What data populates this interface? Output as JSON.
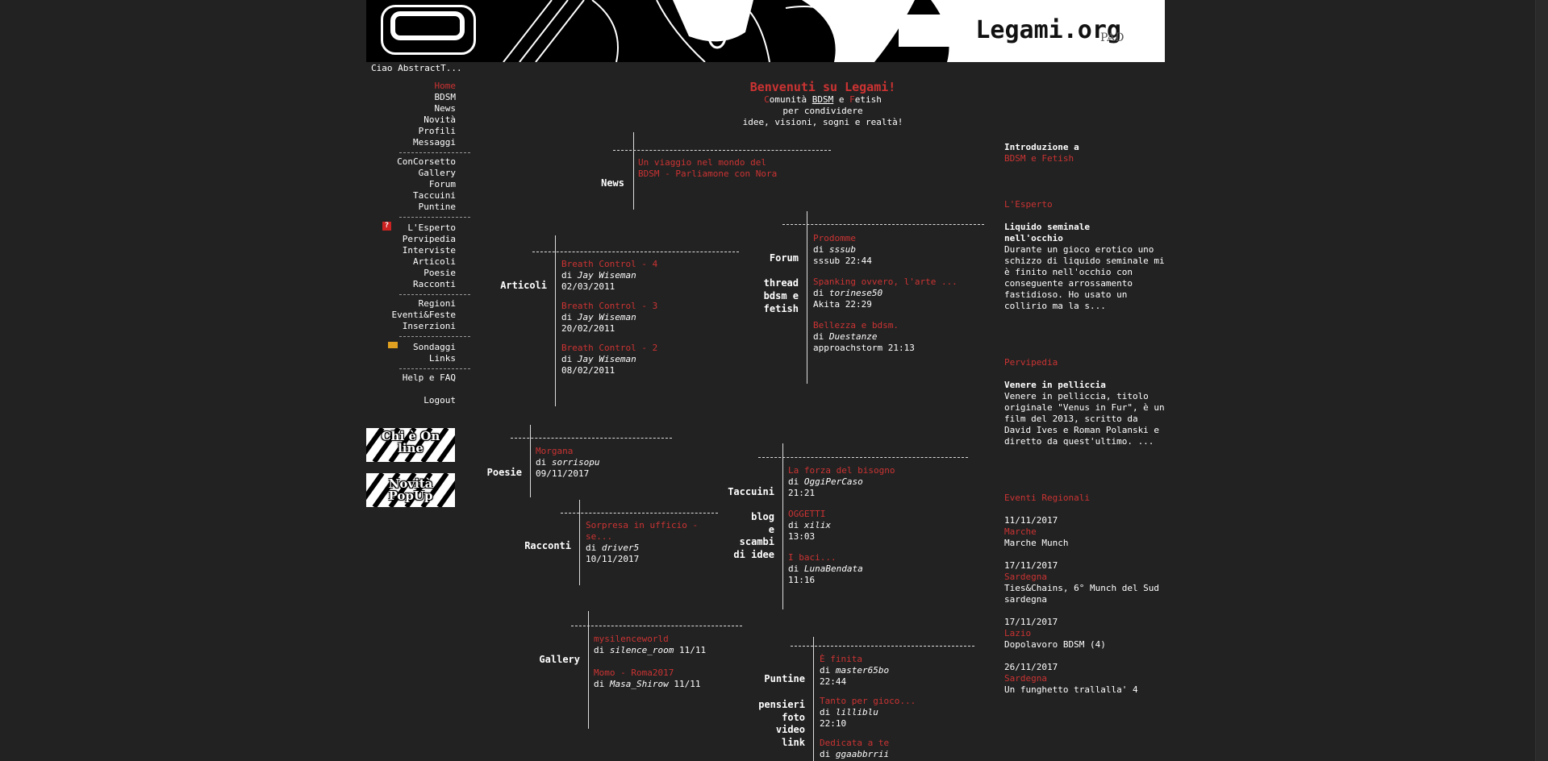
{
  "banner": {
    "site_title": "Legami.org",
    "signature": "PAD"
  },
  "greeting": "Ciao AbstractT...",
  "sidebar": {
    "group1": [
      "Home",
      "BDSM",
      "News",
      "Novità",
      "Profili",
      "Messaggi"
    ],
    "group2": [
      "ConCorsetto",
      "Gallery",
      "Forum",
      "Taccuini",
      "Puntine"
    ],
    "group3": [
      "L'Esperto",
      "Pervipedia",
      "Interviste",
      "Articoli",
      "Poesie",
      "Racconti"
    ],
    "group4": [
      "Regioni",
      "Eventi&Feste",
      "Inserzioni"
    ],
    "group5": [
      "Sondaggi",
      "Links"
    ],
    "group6": [
      "Help e FAQ"
    ],
    "logout": "Logout",
    "badge_online": "Chi è On line",
    "badge_popup": "Novità PopUp"
  },
  "welcome": {
    "title": "Benvenuti su Legami!",
    "line1_a": "C",
    "line1_b": "omunità ",
    "line1_c": "BDSM",
    "line1_d": " e ",
    "line1_e": "F",
    "line1_f": "etish",
    "line2": "per condividere",
    "line3": "idee, visioni, sogni e realtà!"
  },
  "news": {
    "label": "News",
    "item": "Un viaggio nel mondo del BDSM - Parliamone con Nora"
  },
  "articoli": {
    "label": "Articoli",
    "items": [
      {
        "title": "Breath Control - 4",
        "by": "di ",
        "author": "Jay Wiseman",
        "date": "02/03/2011"
      },
      {
        "title": "Breath Control - 3",
        "by": "di ",
        "author": "Jay Wiseman",
        "date": "20/02/2011"
      },
      {
        "title": "Breath Control - 2",
        "by": "di ",
        "author": "Jay Wiseman",
        "date": "08/02/2011"
      }
    ]
  },
  "forum": {
    "label": "Forum",
    "sublabel": [
      "thread",
      "bdsm e",
      "fetish"
    ],
    "items": [
      {
        "title": "Prodomme",
        "by": "di ",
        "author": "sssub",
        "meta": "sssub 22:44"
      },
      {
        "title": "Spanking ovvero, l'arte ...",
        "by": "di ",
        "author": "torinese50",
        "meta": "Akita 22:29"
      },
      {
        "title": "Bellezza e bdsm.",
        "by": "di ",
        "author": "Duestanze",
        "meta": "approachstorm 21:13"
      }
    ]
  },
  "poesie": {
    "label": "Poesie",
    "item": {
      "title": "Morgana",
      "by": "di ",
      "author": "sorrisopu",
      "date": "09/11/2017"
    }
  },
  "racconti": {
    "label": "Racconti",
    "item": {
      "title": "Sorpresa in ufficio - se...",
      "by": "di ",
      "author": "driver5",
      "date": "10/11/2017"
    }
  },
  "taccuini": {
    "label": "Taccuini",
    "sublabel": [
      "blog",
      "e",
      "scambi",
      "di idee"
    ],
    "items": [
      {
        "title": "La forza del bisogno",
        "by": "di ",
        "author": "OggiPerCaso",
        "time": "21:21"
      },
      {
        "title": "OGGETTI",
        "by": "di ",
        "author": "xilix",
        "time": "13:03"
      },
      {
        "title": "I baci...",
        "by": "di ",
        "author": "LunaBendata",
        "time": "11:16"
      }
    ]
  },
  "gallery": {
    "label": "Gallery",
    "items": [
      {
        "title": "mysilenceworld",
        "by": "di ",
        "author": "silence_room",
        "date": " 11/11"
      },
      {
        "title": "Momo - Roma2017",
        "by": "di ",
        "author": "Masa_Shirow",
        "date": " 11/11"
      }
    ]
  },
  "puntine": {
    "label": "Puntine",
    "sublabel": [
      "pensieri",
      "foto",
      "video",
      "link"
    ],
    "items": [
      {
        "title": "È finita",
        "by": "di ",
        "author": "master65bo",
        "time": "22:44"
      },
      {
        "title": "Tanto per gioco...",
        "by": "di ",
        "author": "lilliblu",
        "time": "22:10"
      },
      {
        "title": "Dedicata a te",
        "by": "di ",
        "author": "ggaabbrrii",
        "time": ""
      }
    ]
  },
  "right": {
    "intro_title": "Introduzione a",
    "intro_link": "BDSM e Fetish",
    "esperto_heading": "L'Esperto",
    "esperto_title": "Liquido seminale nell'occhio",
    "esperto_text": "Durante un gioco erotico uno schizzo di liquido seminale mi è finito nell'occhio con conseguente arrossamento fastidioso. Ho usato un collirio ma la s...",
    "pervipedia_heading": "Pervipedia",
    "pervipedia_title": "Venere in pelliccia",
    "pervipedia_text": "Venere in pelliccia, titolo originale \"Venus in Fur\", è un film del 2013, scritto da David Ives e Roman Polanski e diretto da quest'ultimo. ...",
    "eventi_heading": "Eventi Regionali",
    "eventi": [
      {
        "date": "11/11/2017",
        "region": "Marche",
        "name": "Marche Munch"
      },
      {
        "date": "17/11/2017",
        "region": "Sardegna",
        "name": "Ties&Chains, 6° Munch del Sud sardegna"
      },
      {
        "date": "17/11/2017",
        "region": "Lazio",
        "name": "Dopolavoro BDSM (4)"
      },
      {
        "date": "26/11/2017",
        "region": "Sardegna",
        "name": "Un funghetto trallalla' 4"
      }
    ]
  },
  "colors": {
    "background": "#222222",
    "accent": "#cc3333",
    "text": "#ffffff"
  }
}
